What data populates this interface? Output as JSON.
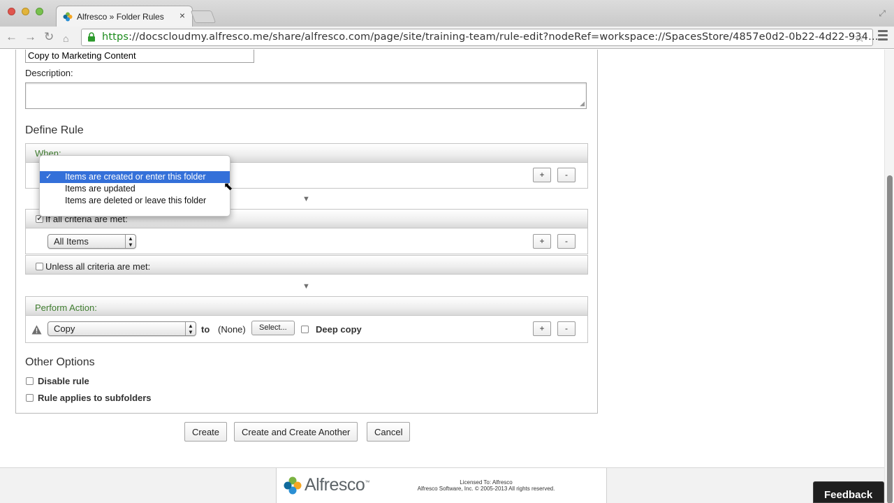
{
  "browser": {
    "tab_title": "Alfresco » Folder Rules",
    "tab_close": "×",
    "url_scheme": "https",
    "url_rest": "://docscloudmy.alfresco.me/share/alfresco.com/page/site/training-team/rule-edit?nodeRef=workspace://SpacesStore/4857e0d2-0b22-4d22-934…",
    "icons": [
      "back-icon",
      "forward-icon",
      "reload-icon",
      "home-icon",
      "lock-icon",
      "star-icon",
      "menu-icon"
    ]
  },
  "form": {
    "name_value": "Copy to Marketing Content",
    "description_label": "Description:",
    "description_value": "",
    "define_rule_title": "Define Rule",
    "when": {
      "header": "When:",
      "options": [
        "Items are created or enter this folder",
        "Items are updated",
        "Items are deleted or leave this folder"
      ],
      "selected_index": 0,
      "check_mark": "✓"
    },
    "if_all": {
      "checked": true,
      "label": "If all criteria are met:",
      "select_value": "All Items"
    },
    "unless_all": {
      "checked": false,
      "label": "Unless all criteria are met:"
    },
    "perform_action": {
      "header": "Perform Action:",
      "select_value": "Copy",
      "to_label": "to",
      "target_value": "(None)",
      "select_button": "Select...",
      "deep_copy_label": "Deep copy",
      "deep_copy_checked": false
    },
    "add_symbol": "+",
    "remove_symbol": "-",
    "other_options_title": "Other Options",
    "disable_rule_label": "Disable rule",
    "subfolders_label": "Rule applies to subfolders"
  },
  "actions": {
    "create": "Create",
    "create_another": "Create and Create Another",
    "cancel": "Cancel"
  },
  "footer": {
    "logo_text": "Alfresco",
    "logo_tm": "™",
    "licensed_to": "Licensed To: Alfresco",
    "copyright": "Alfresco Software, Inc. © 2005-2013 All rights reserved.",
    "feedback": "Feedback"
  },
  "colors": {
    "accent_green": "#3e7b2e",
    "selection_blue": "#3470d9"
  }
}
